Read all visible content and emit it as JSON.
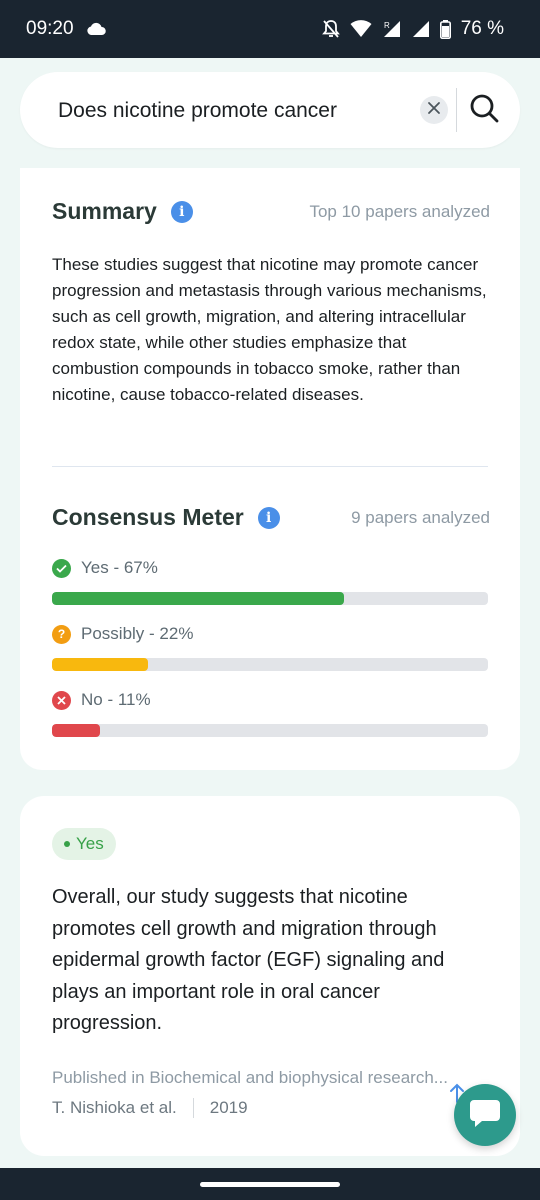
{
  "status_bar": {
    "time": "09:20",
    "battery": "76 %",
    "icons": [
      "cloud-icon",
      "bell-off-icon",
      "wifi-icon",
      "signal-icon",
      "roaming-signal-icon",
      "battery-icon"
    ]
  },
  "search": {
    "query": "Does nicotine promote cancer",
    "clear_icon": "close-icon",
    "submit_icon": "search-icon"
  },
  "summary": {
    "title": "Summary",
    "meta": "Top 10 papers analyzed",
    "text": "These studies suggest that nicotine may promote cancer progression and metastasis through various mechanisms, such as cell growth, migration, and altering intracellular redox state, while other studies emphasize that combustion compounds in tobacco smoke, rather than nicotine, cause tobacco-related diseases."
  },
  "consensus": {
    "title": "Consensus Meter",
    "meta": "9 papers analyzed",
    "items": [
      {
        "label": "Yes - 67%",
        "value": 67,
        "color": "#3aa84b",
        "icon": "check-circle-icon"
      },
      {
        "label": "Possibly - 22%",
        "value": 22,
        "color": "#f8b80e",
        "icon": "question-circle-icon"
      },
      {
        "label": "No - 11%",
        "value": 11,
        "color": "#e0474c",
        "icon": "x-circle-icon"
      }
    ]
  },
  "paper": {
    "badge": "Yes",
    "text": "Overall, our study suggests that nicotine promotes cell growth and migration through epidermal growth factor (EGF) signaling and plays an important role in oral cancer progression.",
    "journal": "Published in Biochemical and biophysical research...",
    "authors": "T. Nishioka et al.",
    "year": "2019"
  },
  "colors": {
    "accent": "#2d9a8c",
    "info": "#4a8fe8",
    "status_bar": "#1a2530"
  }
}
